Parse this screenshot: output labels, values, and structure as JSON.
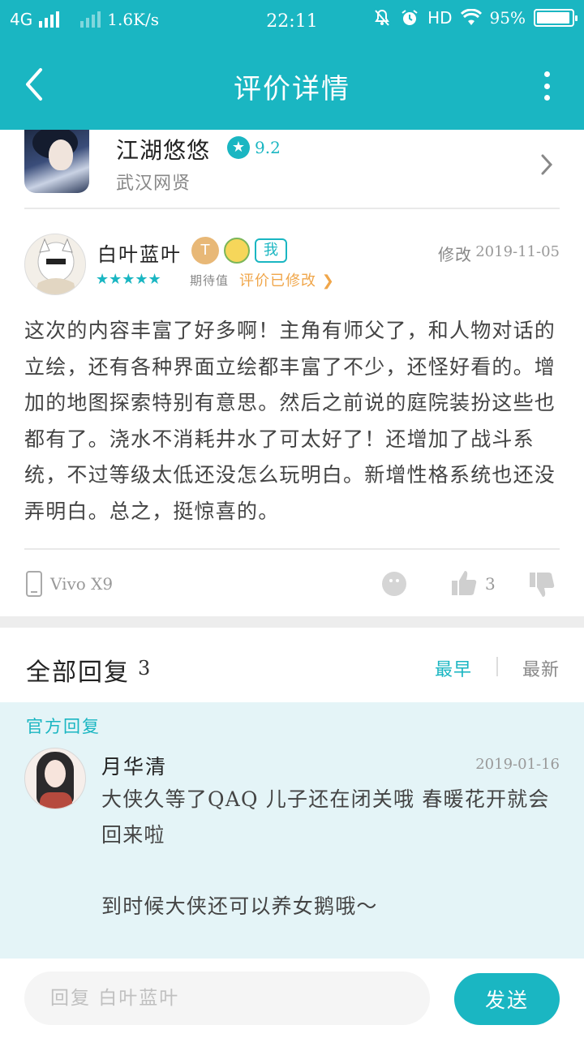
{
  "status_bar": {
    "network": "4G",
    "speed": "1.6K/s",
    "time": "22:11",
    "hd": "HD",
    "battery": "95%",
    "battery_level": 0.95
  },
  "nav": {
    "title": "评价详情"
  },
  "game": {
    "name": "江湖悠悠",
    "score": "9.2",
    "developer": "武汉网贤"
  },
  "review": {
    "username": "白叶蓝叶",
    "level_badge": "T",
    "me_badge": "我",
    "modify_label": "修改",
    "date": "2019-11-05",
    "stars": 5,
    "star_glyphs": "★★★★★",
    "expect_label": "期待值",
    "edited_label": "评价已修改 ❯",
    "content": "这次的内容丰富了好多啊！主角有师父了，和人物对话的立绘，还有各种界面立绘都丰富了不少，还怪好看的。增加的地图探索特别有意思。然后之前说的庭院装扮这些也都有了。浇水不消耗井水了可太好了！还增加了战斗系统，不过等级太低还没怎么玩明白。新增性格系统也还没弄明白。总之，挺惊喜的。",
    "device": "Vivo X9",
    "like_count": "3"
  },
  "replies": {
    "title": "全部回复",
    "count": "3",
    "sort_earliest": "最早",
    "sort_newest": "最新",
    "official_label": "官方回复",
    "official": {
      "name": "月华清",
      "date": "2019-01-16",
      "content": "大侠久等了QAQ  儿子还在闭关哦  春暖花开就会回来啦\n\n到时候大侠还可以养女鹅哦～"
    }
  },
  "composer": {
    "placeholder": "回复 白叶蓝叶",
    "send_label": "发送"
  },
  "colors": {
    "accent": "#1ab6c2",
    "edited": "#f0a64a",
    "official_bg": "#e4f4f7"
  },
  "icons": [
    "back-icon",
    "more-icon",
    "rating-star-icon",
    "chevron-right-icon",
    "phone-icon",
    "emoji-icon",
    "thumbs-up-icon",
    "thumbs-down-icon",
    "wifi-icon",
    "alarm-icon",
    "mute-icon"
  ]
}
